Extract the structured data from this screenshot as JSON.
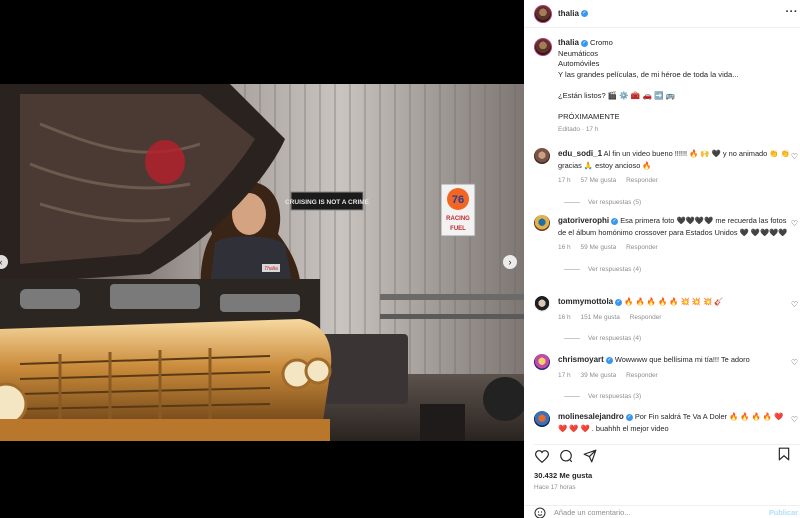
{
  "post": {
    "username": "thalia",
    "more_icon": "more-horizontal-icon",
    "caption": {
      "username": "thalia",
      "first_line": "Cromo",
      "lines": [
        "Neumáticos",
        "Automóviles",
        "Y las grandes películas, de mi héroe de toda la vida..."
      ],
      "question": "¿Están listos? 🎬 ⚙️ 🧰 🚗 ➡️ 🚌",
      "coming_soon": "PRÓXIMAMENTE",
      "edited": "Editado · 17 h"
    },
    "photo_signs": {
      "cruising": "CRUISING IS NOT A CRIME",
      "badge_number": "76",
      "badge_text_1": "RACING",
      "badge_text_2": "FUEL",
      "name_patch": "Thalia"
    }
  },
  "comments": [
    {
      "username": "edu_sodi_1",
      "verified": false,
      "text": "Al fin un video bueno !!!!!! 🔥 🙌 🖤 y no animado 👏 👏 gracias 🙏 estoy ancioso 🔥",
      "age": "17 h",
      "likes": "57 Me gusta",
      "reply": "Responder",
      "view_replies": "Ver respuestas (5)"
    },
    {
      "username": "gatoriverophi",
      "verified": true,
      "text": "Esa primera foto 🖤🖤🖤🖤 me recuerda las fotos de el álbum homónimo crossover para Estados Unidos 🖤 🖤🖤🖤🖤",
      "age": "16 h",
      "likes": "59 Me gusta",
      "reply": "Responder",
      "view_replies": "Ver respuestas (4)"
    },
    {
      "username": "tommymottola",
      "verified": true,
      "text": "🔥 🔥 🔥 🔥 🔥 💥 💥 💥 🎸",
      "age": "16 h",
      "likes": "151 Me gusta",
      "reply": "Responder",
      "view_replies": "Ver respuestas (4)"
    },
    {
      "username": "chrismoyart",
      "verified": true,
      "text": "Wowwww que bellísima mi tía!!! Te adoro",
      "age": "17 h",
      "likes": "39 Me gusta",
      "reply": "Responder",
      "view_replies": "Ver respuestas (3)"
    },
    {
      "username": "molinesalejandro",
      "verified": true,
      "text": "Por Fin saldrá Te Va A Doler 🔥 🔥 🔥 🔥 ❤️ ❤️ ❤️ ❤️ . buahhh el mejor video",
      "age": "",
      "likes": "",
      "reply": "",
      "view_replies": ""
    }
  ],
  "actions": {
    "like_icon": "heart-icon",
    "comment_icon": "comment-icon",
    "share_icon": "share-icon",
    "save_icon": "bookmark-icon"
  },
  "likes_count": "30.432 Me gusta",
  "timestamp": "Hace 17 horas",
  "add_comment": {
    "placeholder": "Añade un comentario...",
    "publish": "Publicar"
  },
  "colors": {
    "verified": "#3897f0",
    "meta_gray": "#8e8e8e",
    "text": "#262626"
  }
}
